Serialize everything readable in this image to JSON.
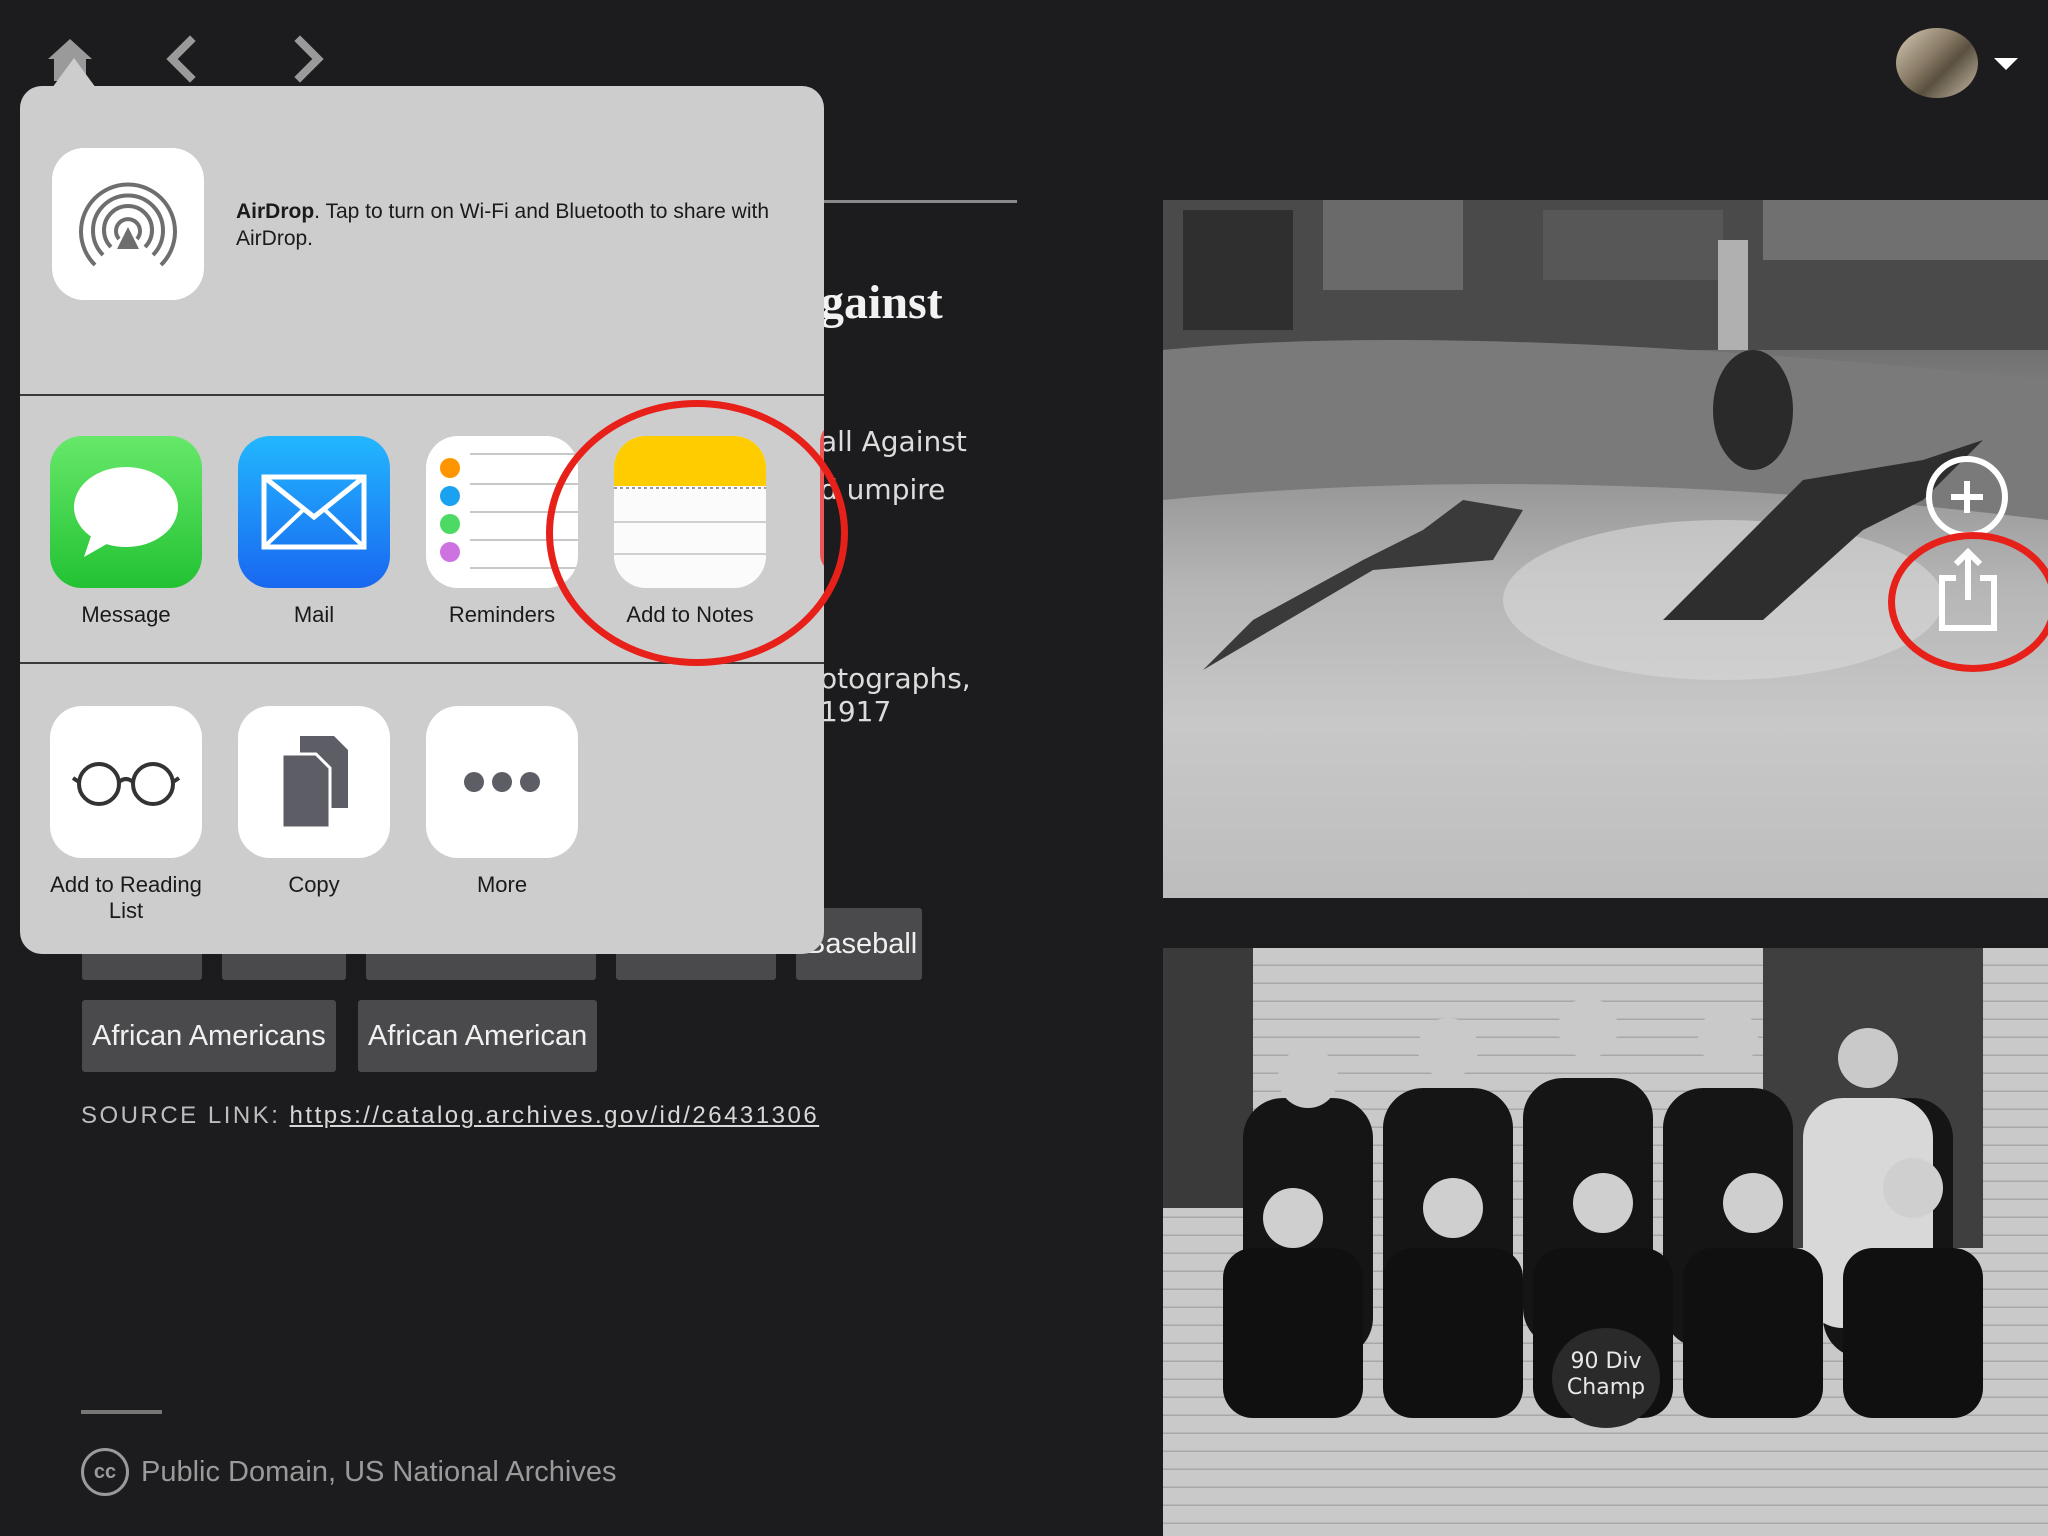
{
  "nav": {
    "home_icon": "home-icon",
    "back_icon": "chevron-left-icon",
    "forward_icon": "chevron-right-icon"
  },
  "article": {
    "title_fragment": "gainst",
    "desc_line1": "all Against",
    "desc_line2": "d umpire",
    "series_fragment": "otographs, 1917",
    "tags_row1": [
      "",
      "",
      "",
      "",
      "Baseball"
    ],
    "tags_row2": [
      "African Americans",
      "African American"
    ],
    "source_label": "SOURCE LINK:",
    "source_url": "https://catalog.archives.gov/id/26431306",
    "license_icon": "cc",
    "license": "Public Domain, US National Archives"
  },
  "photo": {
    "badge_text_1": "90 Div",
    "badge_text_2": "Champ"
  },
  "share_sheet": {
    "airdrop": {
      "name": "AirDrop",
      "text": ". Tap to turn on Wi-Fi and Bluetooth to share with AirDrop."
    },
    "apps": [
      {
        "label": "Message",
        "icon": "message-icon"
      },
      {
        "label": "Mail",
        "icon": "mail-icon"
      },
      {
        "label": "Reminders",
        "icon": "reminders-icon"
      },
      {
        "label": "Add to Notes",
        "icon": "notes-icon"
      }
    ],
    "actions": [
      {
        "label": "Add to Reading List",
        "icon": "glasses-icon"
      },
      {
        "label": "Copy",
        "icon": "copy-icon"
      },
      {
        "label": "More",
        "icon": "more-icon"
      }
    ]
  },
  "colors": {
    "background": "#1c1c1e",
    "sheet": "#cdcdcd",
    "highlight_ring": "#e8201a",
    "tag": "#4a4a4c"
  }
}
